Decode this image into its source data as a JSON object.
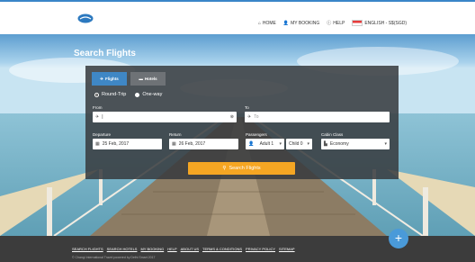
{
  "header": {
    "nav": {
      "home": "HOME",
      "my_booking": "MY BOOKING",
      "help": "HELP",
      "language": "ENGLISH - S$(SGD)"
    }
  },
  "page": {
    "title": "Search Flights"
  },
  "search": {
    "tabs": {
      "flights": "Flights",
      "hotels": "Hotels"
    },
    "trip": {
      "round_trip": "Round-Trip",
      "one_way": "One-way",
      "selected": "round_trip"
    },
    "from": {
      "label": "From",
      "value": "|"
    },
    "to": {
      "label": "To",
      "placeholder": "To"
    },
    "departure": {
      "label": "Departure",
      "value": "25 Feb, 2017"
    },
    "return": {
      "label": "Return",
      "value": "26 Feb, 2017"
    },
    "passengers": {
      "label": "Passengers",
      "adult": "Adult 1",
      "child": "Child 0"
    },
    "cabin": {
      "label": "Cabin Class",
      "value": "Economy"
    },
    "button": "Search Flights"
  },
  "footer": {
    "links": [
      "SEARCH FLIGHTS",
      "SEARCH HOTELS",
      "MY BOOKING",
      "HELP",
      "ABOUT US",
      "TERMS & CONDITIONS",
      "PRIVACY POLICY",
      "SITEMAP"
    ],
    "copyright": "© Changi International Travel powered by Delhi Smart 2017"
  },
  "colors": {
    "accent": "#3f87c5",
    "button": "#f5a623",
    "footer": "#3c3c3c"
  },
  "icons": [
    "logo-icon",
    "home-icon",
    "user-icon",
    "help-icon",
    "flag-icon",
    "plane-icon",
    "bed-icon",
    "calendar-icon",
    "person-icon",
    "seat-icon",
    "search-icon",
    "plus-icon"
  ]
}
